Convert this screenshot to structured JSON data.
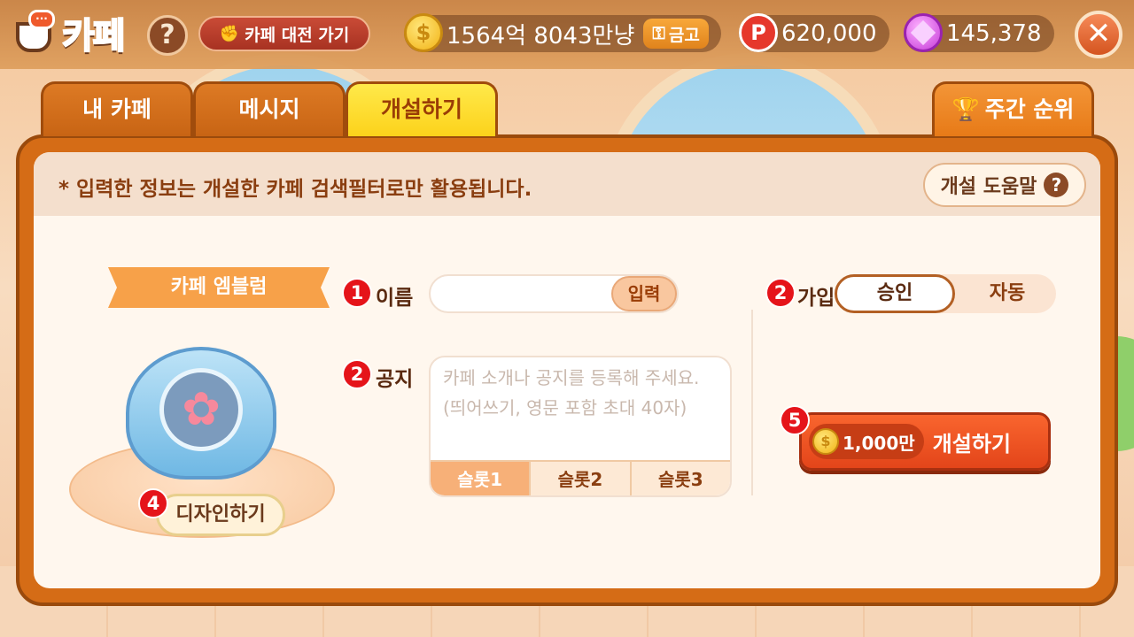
{
  "header": {
    "logo_text": "카페",
    "battle_button": "카페 대전 가기",
    "currency": {
      "gold_amount": "1564억 8043만냥",
      "vault_button": "금고",
      "points": "620,000",
      "gems": "145,378"
    }
  },
  "tabs": [
    {
      "label": "내 카페"
    },
    {
      "label": "메시지"
    },
    {
      "label": "개설하기"
    },
    {
      "label": "주간 순위"
    }
  ],
  "notice": {
    "text": "* 입력한 정보는 개설한 카페 검색필터로만 활용됩니다.",
    "help_button": "개설 도움말"
  },
  "emblem": {
    "title": "카페 엠블럼",
    "design_button": "디자인하기"
  },
  "form": {
    "steps": {
      "name": "1",
      "notice": "2",
      "join": "2",
      "design": "4",
      "create": "5"
    },
    "name_label": "이름",
    "name_button": "입력",
    "notice_label": "공지",
    "notice_placeholder": "카페 소개나 공지를 등록해 주세요. (띄어쓰기, 영문 포함 초대 40자)",
    "slots": [
      "슬롯1",
      "슬롯2",
      "슬롯3"
    ],
    "join_label": "가입",
    "join_options": [
      "승인",
      "자동"
    ],
    "cost": "1,000만",
    "create_button": "개설하기"
  }
}
